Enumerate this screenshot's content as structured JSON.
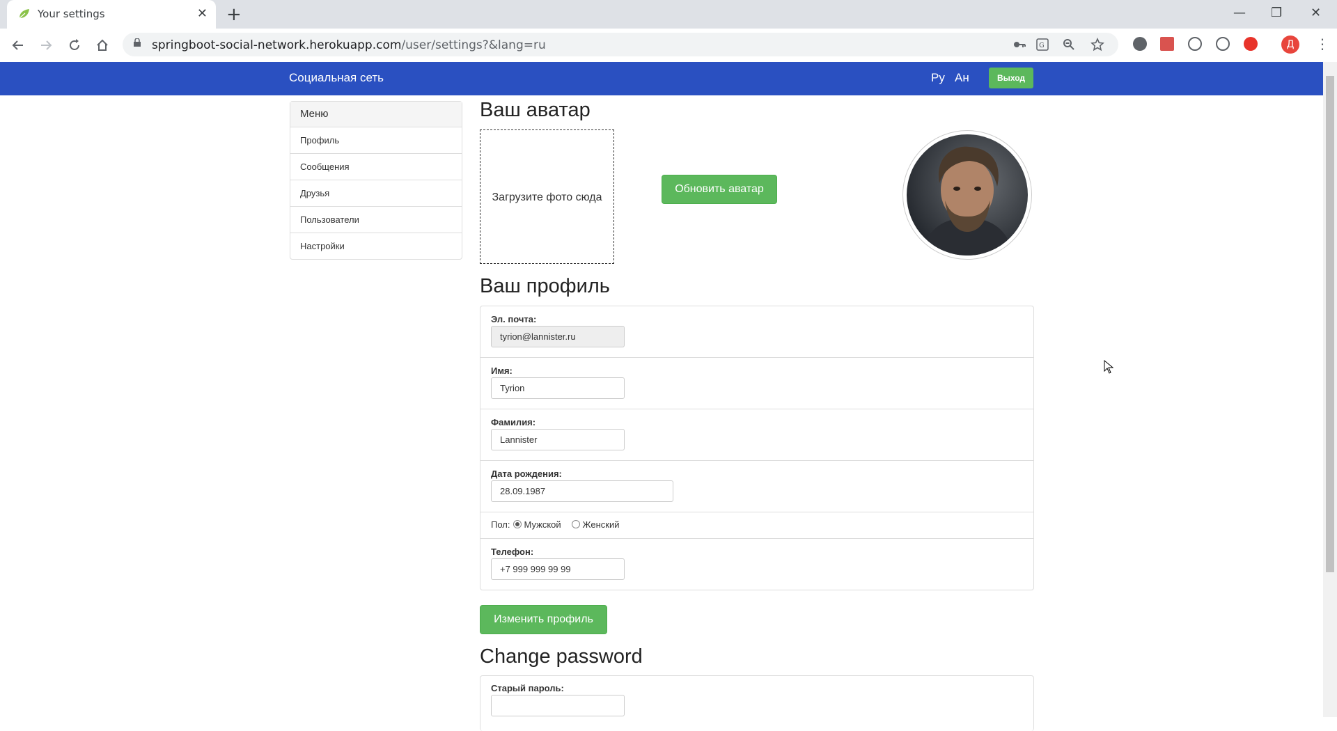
{
  "browser": {
    "tab_title": "Your settings",
    "tab_close": "✕",
    "new_tab": "+",
    "url_host": "springboot-social-network.herokuapp.com",
    "url_path": "/user/settings?&lang=ru",
    "profile_initial": "Д",
    "minimize": "—",
    "maximize": "❐",
    "close": "✕"
  },
  "navbar": {
    "brand": "Социальная сеть",
    "lang_ru": "Ру",
    "lang_en": "Ан",
    "logout": "Выход",
    "color": "#2a50c1"
  },
  "menu": {
    "title": "Меню",
    "items": [
      "Профиль",
      "Сообщения",
      "Друзья",
      "Пользователи",
      "Настройки"
    ]
  },
  "avatar": {
    "heading": "Ваш аватар",
    "dropzone": "Загрузите фото сюда",
    "update_button": "Обновить аватар"
  },
  "profile": {
    "heading": "Ваш профиль",
    "email_label": "Эл. почта:",
    "email_value": "tyrion@lannister.ru",
    "name_label": "Имя:",
    "name_value": "Tyrion",
    "surname_label": "Фамилия:",
    "surname_value": "Lannister",
    "birth_label": "Дата рождения:",
    "birth_value": "28.09.1987",
    "gender_label": "Пол:",
    "gender_male": "Мужской",
    "gender_female": "Женский",
    "phone_label": "Телефон:",
    "phone_value": "+7 999 999 99 99",
    "submit": "Изменить профиль"
  },
  "password": {
    "heading": "Change password",
    "old_label": "Старый пароль:"
  },
  "colors": {
    "accent_green": "#5cb85c"
  }
}
